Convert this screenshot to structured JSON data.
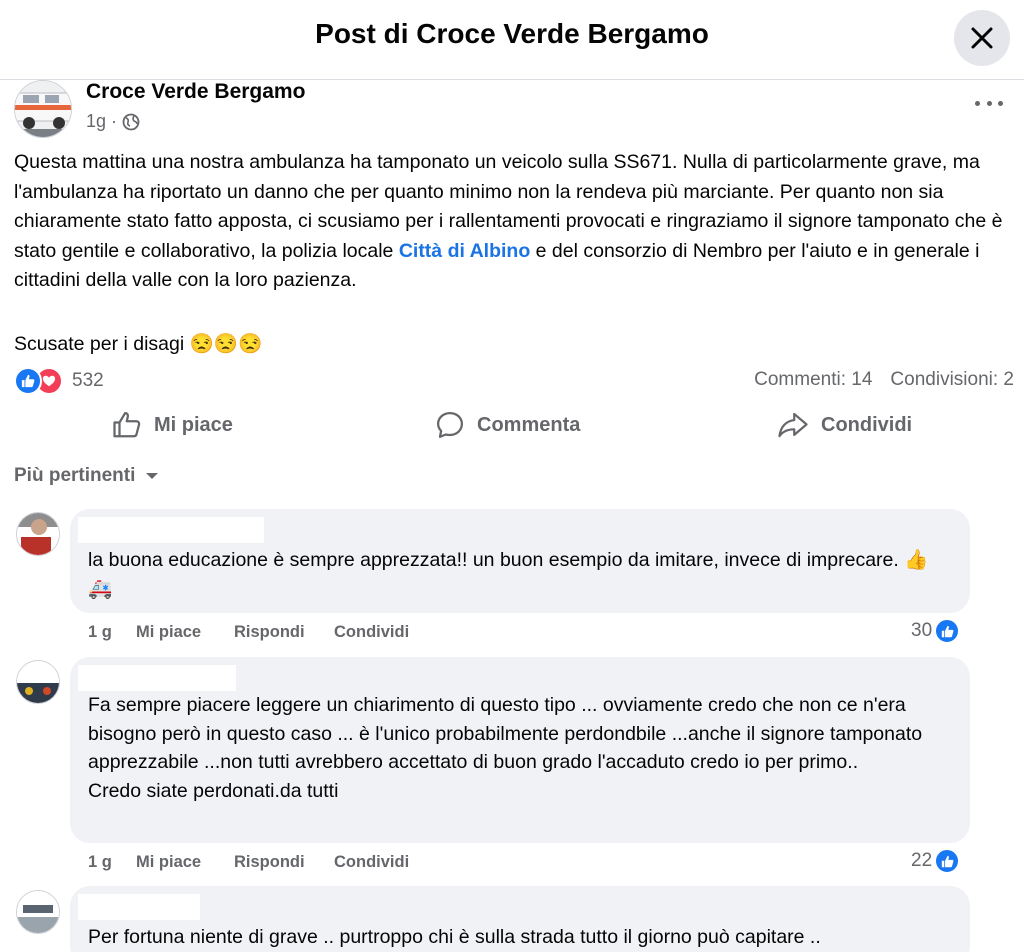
{
  "header": {
    "title": "Post di Croce Verde Bergamo"
  },
  "post": {
    "author": "Croce Verde Bergamo",
    "time": "1g",
    "text_before_link": "Questa mattina una nostra ambulanza ha tamponato un veicolo sulla SS671. Nulla di particolarmente grave, ma l'ambulanza ha riportato un danno che per quanto minimo non la rendeva più marciante. Per quanto non sia chiaramente stato fatto apposta, ci scusiamo per i rallentamenti provocati e ringraziamo il signore tamponato che è stato gentile e collaborativo, la polizia locale ",
    "link": "Città di Albino",
    "text_after_link": " e del consorzio di Nembro per l'aiuto e in generale i cittadini della valle con la loro pazienza.",
    "text2": "Scusate per i disagi 😒😒😒",
    "reactions_count": "532",
    "comments_count": "Commenti: 14",
    "shares_count": "Condivisioni: 2",
    "actions": {
      "like": "Mi piace",
      "comment": "Commenta",
      "share": "Condividi"
    }
  },
  "sort": {
    "label": "Più pertinenti"
  },
  "comments": [
    {
      "text": "la buona educazione è sempre apprezzata!! un buon esempio da imitare, invece di imprecare. 👍🚑",
      "time": "1 g",
      "like": "Mi piace",
      "reply": "Rispondi",
      "share": "Condividi",
      "likes": "30"
    },
    {
      "text": "Fa sempre piacere leggere un chiarimento di questo tipo ... ovviamente credo che non ce n'era bisogno però in questo caso ... è l'unico probabilmente perdondbile ...anche il signore tamponato apprezzabile ...non tutti avrebbero accettato di buon grado l'accaduto credo io per primo..\nCredo siate perdonati.da tutti",
      "time": "1 g",
      "like": "Mi piace",
      "reply": "Rispondi",
      "share": "Condividi",
      "likes": "22"
    },
    {
      "text": "Per fortuna niente di grave .. purtroppo chi è sulla strada tutto il giorno può capitare .."
    }
  ],
  "colors": {
    "accent": "#1877f2",
    "link": "#1b74e4",
    "love": "#f33e58",
    "muted": "#65676b",
    "bubble": "#f0f2f5"
  }
}
